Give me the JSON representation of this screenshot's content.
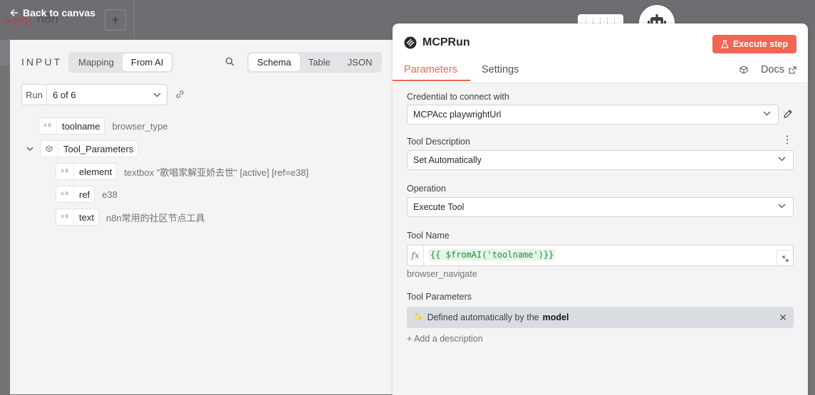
{
  "canvas": {
    "back_label": "Back to canvas",
    "workflow_title": "n8n"
  },
  "input": {
    "label": "INPUT",
    "modes": [
      "Mapping",
      "From AI"
    ],
    "views": [
      "Schema",
      "Table",
      "JSON"
    ],
    "run": {
      "label": "Run",
      "value": "6 of 6"
    },
    "tree": [
      {
        "type": "A B",
        "name": "toolname",
        "value": "browser_type"
      },
      {
        "type": "cube",
        "name": "Tool_Parameters",
        "value": ""
      },
      {
        "type": "A B",
        "name": "element",
        "value": "textbox \"歌唱家解亚娇去世\" [active] [ref=e38]"
      },
      {
        "type": "A B",
        "name": "ref",
        "value": "e38"
      },
      {
        "type": "A B",
        "name": "text",
        "value": "n8n常用的社区节点工具"
      }
    ]
  },
  "node": {
    "title": "MCPRun",
    "execute_label": "Execute step",
    "tabs": [
      "Parameters",
      "Settings"
    ],
    "docs_label": "Docs"
  },
  "params": {
    "credential_label": "Credential to connect with",
    "credential_value": "MCPAcc playwrightUrl",
    "tool_desc_label": "Tool Description",
    "tool_desc_value": "Set Automatically",
    "operation_label": "Operation",
    "operation_value": "Execute Tool",
    "tool_name_label": "Tool Name",
    "tool_name_expr": "{{ $fromAI('toolname')}}",
    "tool_name_hint": "browser_navigate",
    "tool_params_label": "Tool Parameters",
    "defined_prefix": "Defined automatically by the",
    "defined_bold": "model",
    "add_description": "+ Add a description"
  },
  "colors": {
    "accent": "#f06653",
    "panel_bg": "#f4f4f5",
    "overlay": "#737373"
  }
}
